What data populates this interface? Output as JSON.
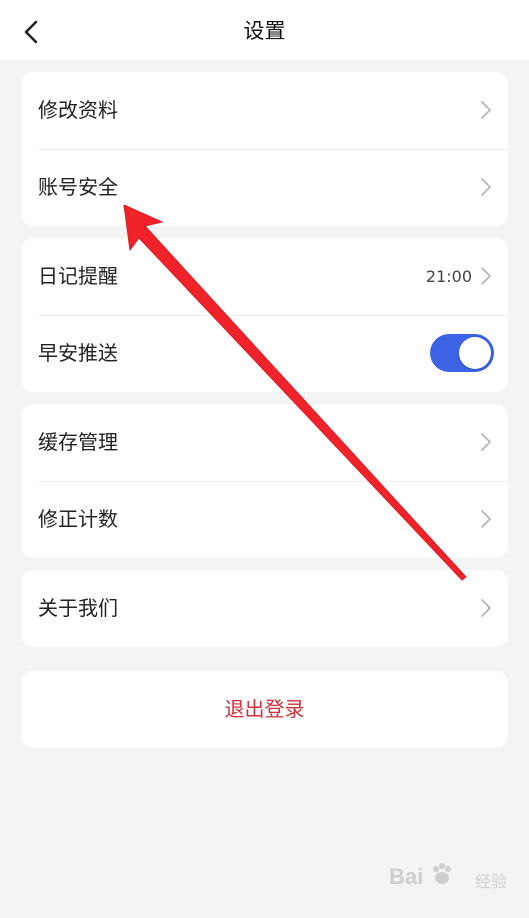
{
  "header": {
    "title": "设置",
    "back_icon": "chevron-left-icon"
  },
  "groups": [
    {
      "items": [
        {
          "label": "修改资料"
        },
        {
          "label": "账号安全"
        }
      ]
    },
    {
      "items": [
        {
          "label": "日记提醒",
          "value": "21:00"
        },
        {
          "label": "早安推送",
          "toggle_on": true
        }
      ]
    },
    {
      "items": [
        {
          "label": "缓存管理"
        },
        {
          "label": "修正计数"
        }
      ]
    },
    {
      "items": [
        {
          "label": "关于我们"
        }
      ]
    }
  ],
  "logout": {
    "label": "退出登录"
  },
  "colors": {
    "accent": "#3b63e3",
    "danger": "#d2303a",
    "annotation_arrow": "#f0222a",
    "background": "#f4f4f4"
  },
  "watermark": {
    "brand": "Bai",
    "suffix": "经验"
  }
}
